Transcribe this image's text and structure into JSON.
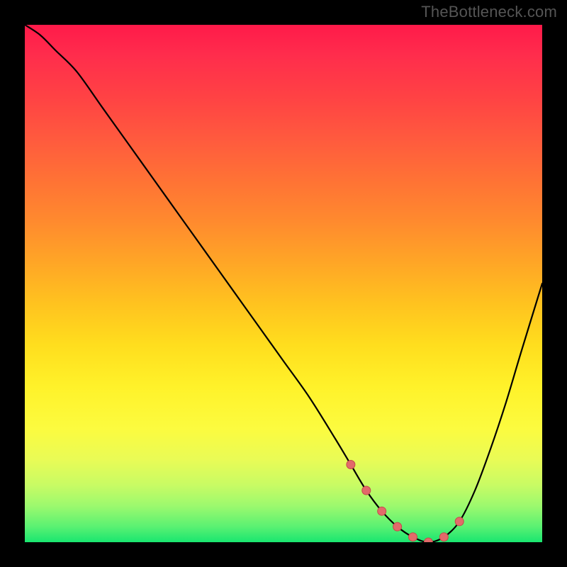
{
  "watermark": "TheBottleneck.com",
  "colors": {
    "page_background": "#000000",
    "gradient_top": "#ff1a4a",
    "gradient_bottom": "#19e670",
    "curve_stroke": "#000000",
    "marker_fill": "#e26a6a",
    "marker_stroke": "#c44a4a"
  },
  "chart_data": {
    "type": "line",
    "title": "",
    "xlabel": "",
    "ylabel": "",
    "xlim": [
      0,
      100
    ],
    "ylim": [
      0,
      100
    ],
    "grid": false,
    "legend": false,
    "background_gradient": "vertical red→yellow→green",
    "series": [
      {
        "name": "bottleneck-curve",
        "x": [
          0,
          3,
          6,
          10,
          15,
          20,
          25,
          30,
          35,
          40,
          45,
          50,
          55,
          60,
          63,
          66,
          69,
          72,
          75,
          78,
          81,
          84,
          87,
          90,
          93,
          96,
          100
        ],
        "y": [
          100,
          98,
          95,
          91,
          84,
          77,
          70,
          63,
          56,
          49,
          42,
          35,
          28,
          20,
          15,
          10,
          6,
          3,
          1,
          0,
          1,
          4,
          10,
          18,
          27,
          37,
          50
        ]
      }
    ],
    "markers": [
      {
        "x": 63,
        "y": 15
      },
      {
        "x": 66,
        "y": 10
      },
      {
        "x": 69,
        "y": 6
      },
      {
        "x": 72,
        "y": 3
      },
      {
        "x": 75,
        "y": 1
      },
      {
        "x": 78,
        "y": 0
      },
      {
        "x": 81,
        "y": 1
      },
      {
        "x": 84,
        "y": 4
      }
    ],
    "notes": "Axes are unlabeled; ticks not shown. y=100 maps to top of colored square, y=0 to bottom. Values estimated from pixel positions."
  }
}
